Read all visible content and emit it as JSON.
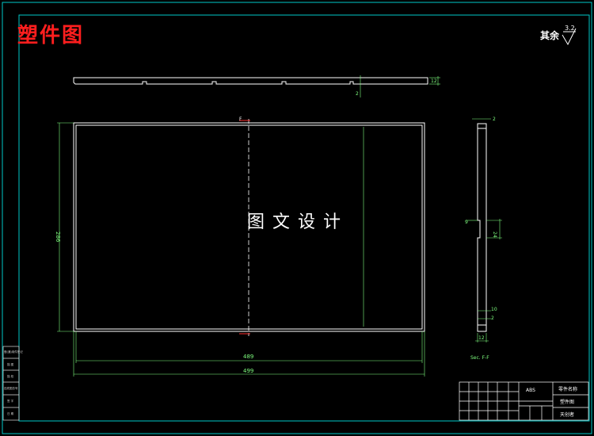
{
  "drawing": {
    "title": "塑件图",
    "watermark": "图文设计",
    "roughness_label": "其余",
    "roughness_value": "3.2",
    "section_label": "Sec. F-F",
    "section_mark_top": "F",
    "section_mark_bottom": "F"
  },
  "dimensions": {
    "height_left": "286",
    "width_inner": "489",
    "width_outer": "499",
    "top_view_right": "12",
    "top_view_small": "2",
    "section_top": "2",
    "section_mid_left": "9",
    "section_mid_right": "24",
    "section_low": "10",
    "section_low2": "2",
    "section_bottom": "12"
  },
  "title_block": {
    "center_code": "ABS",
    "right_row1": "零件名称",
    "right_row2": "塑件图",
    "right_row3": "天创者"
  },
  "left_strip": [
    "借(通)用件登记",
    "描 图",
    "描 校",
    "旧底图总号",
    "签 字",
    "日 期"
  ],
  "colors": {
    "frame": "#00c8c8",
    "part": "#ffffff",
    "dim": "#7fff7f",
    "title": "#ff1e1e",
    "cut": "#ff3030"
  }
}
